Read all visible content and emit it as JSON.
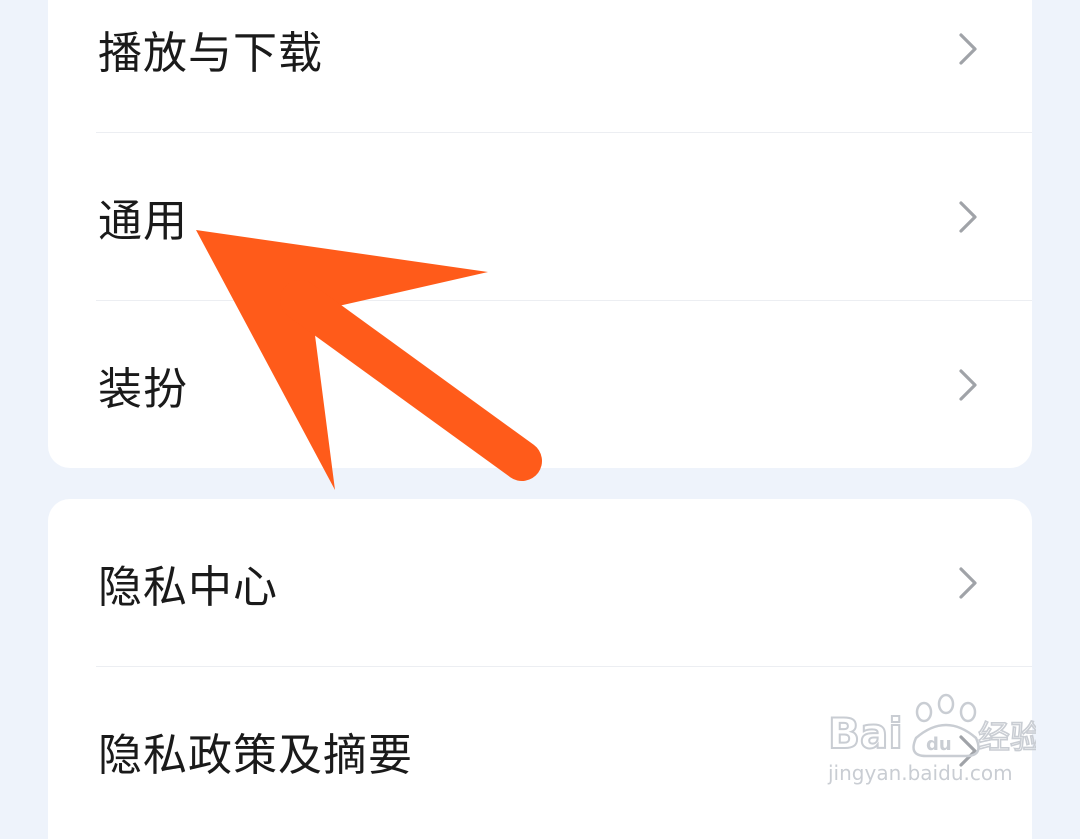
{
  "settings": {
    "group1": [
      {
        "label": "播放与下载"
      },
      {
        "label": "通用"
      },
      {
        "label": "装扮"
      }
    ],
    "group2": [
      {
        "label": "隐私中心"
      },
      {
        "label": "隐私政策及摘要"
      }
    ]
  },
  "annotation": {
    "color": "#ff5b1a",
    "icon": "arrow-pointer-icon"
  },
  "watermark": {
    "brand": "Baidu经验",
    "url": "jingyan.baidu.com"
  },
  "colors": {
    "background": "#eef3fb",
    "card": "#ffffff",
    "text": "#1a1a1a",
    "chevron": "#a0a3a8",
    "divider": "#eceef2"
  }
}
